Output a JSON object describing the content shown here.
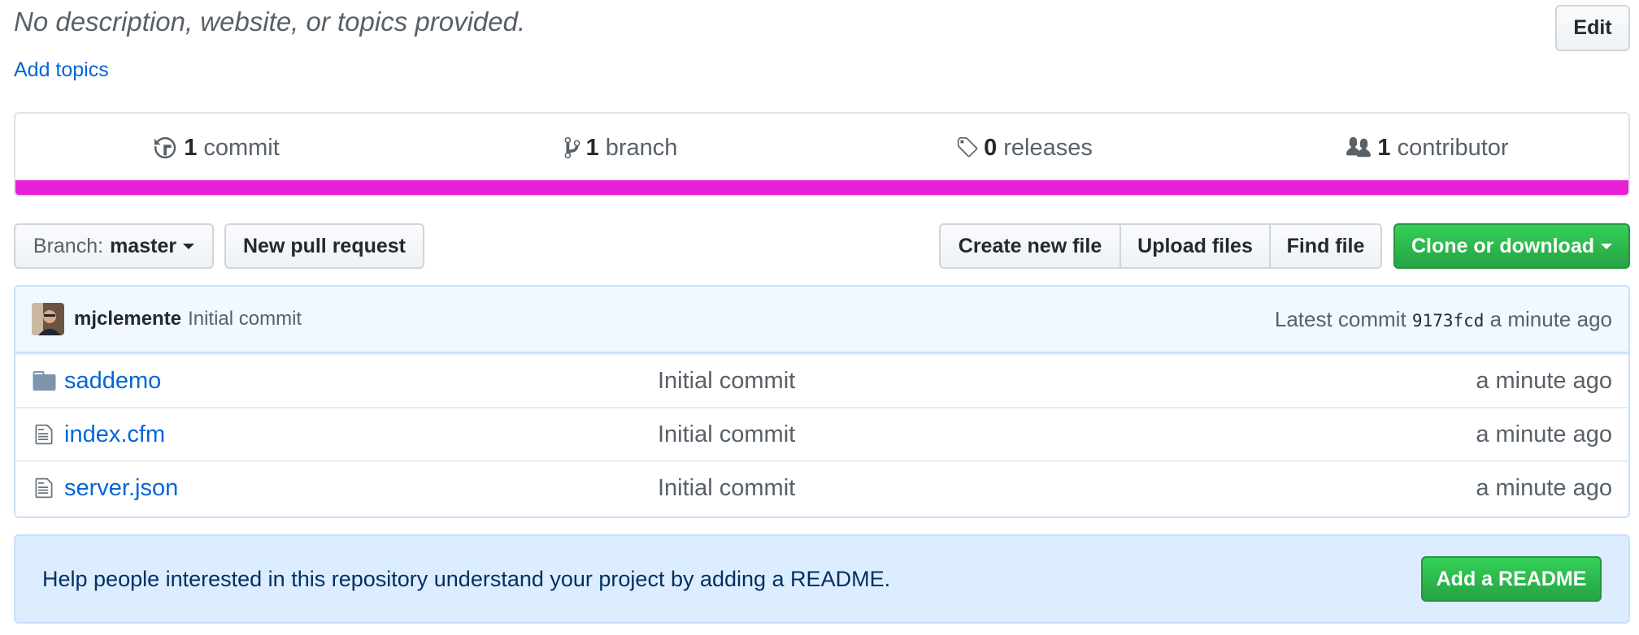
{
  "repo": {
    "description": "No description, website, or topics provided.",
    "add_topics_label": "Add topics",
    "edit_label": "Edit"
  },
  "summary": {
    "commits": {
      "count": "1",
      "label": "commit"
    },
    "branches": {
      "count": "1",
      "label": "branch"
    },
    "releases": {
      "count": "0",
      "label": "releases"
    },
    "contributors": {
      "count": "1",
      "label": "contributor"
    },
    "language_bar_color": "#e71fd5"
  },
  "toolbar": {
    "branch_prefix": "Branch:",
    "branch_name": "master",
    "new_pr_label": "New pull request",
    "create_file_label": "Create new file",
    "upload_files_label": "Upload files",
    "find_file_label": "Find file",
    "clone_label": "Clone or download"
  },
  "latest_commit": {
    "author": "mjclemente",
    "message": "Initial commit",
    "prefix": "Latest commit",
    "sha": "9173fcd",
    "age": "a minute ago"
  },
  "files": [
    {
      "name": "saddemo",
      "type": "folder",
      "icon": "folder-icon",
      "message": "Initial commit",
      "age": "a minute ago"
    },
    {
      "name": "index.cfm",
      "type": "file",
      "icon": "file-icon",
      "message": "Initial commit",
      "age": "a minute ago"
    },
    {
      "name": "server.json",
      "type": "file",
      "icon": "file-icon",
      "message": "Initial commit",
      "age": "a minute ago"
    }
  ],
  "readme_prompt": {
    "text": "Help people interested in this repository understand your project by adding a README.",
    "button_label": "Add a README"
  },
  "colors": {
    "link": "#0366d6",
    "primary_green": "#28a745",
    "tease_bg": "#f1f8ff",
    "readme_bg": "#dbedff"
  }
}
